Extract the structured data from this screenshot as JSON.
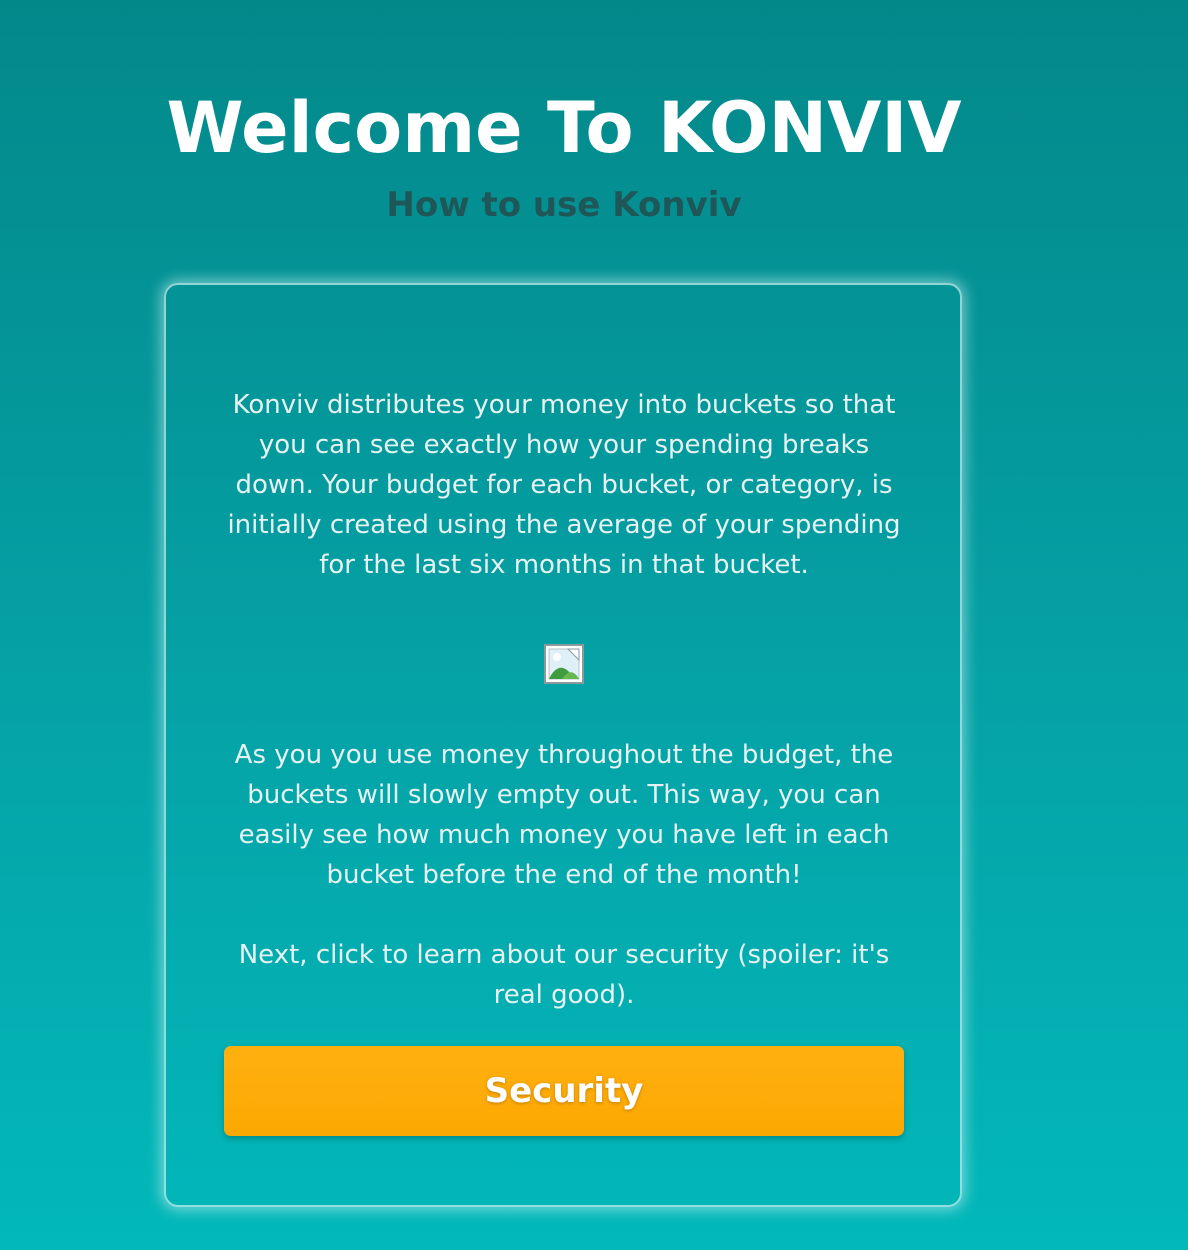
{
  "header": {
    "title": "Welcome To KONVIV",
    "subtitle": "How to use Konviv"
  },
  "card": {
    "paragraph_1": "Konviv distributes your money into buckets so that you can see exactly how your spending breaks down. Your budget for each bucket, or category, is initially created using the average of your spending for the last six months in that bucket.",
    "image_icon": "broken-image-icon",
    "paragraph_2": "As you you use money throughout the budget, the buckets will slowly empty out. This way, you can easily see how much money you have left in each bucket before the end of the month!",
    "paragraph_3": "Next, click to learn about our security (spoiler: it's real good).",
    "button_label": "Security"
  },
  "colors": {
    "background_top": "#03888a",
    "background_bottom": "#02b8ba",
    "title": "#ffffff",
    "subtitle": "#1f5657",
    "body_text": "#e6f2f1",
    "button": "#fdab06",
    "button_text": "#ffffff"
  }
}
